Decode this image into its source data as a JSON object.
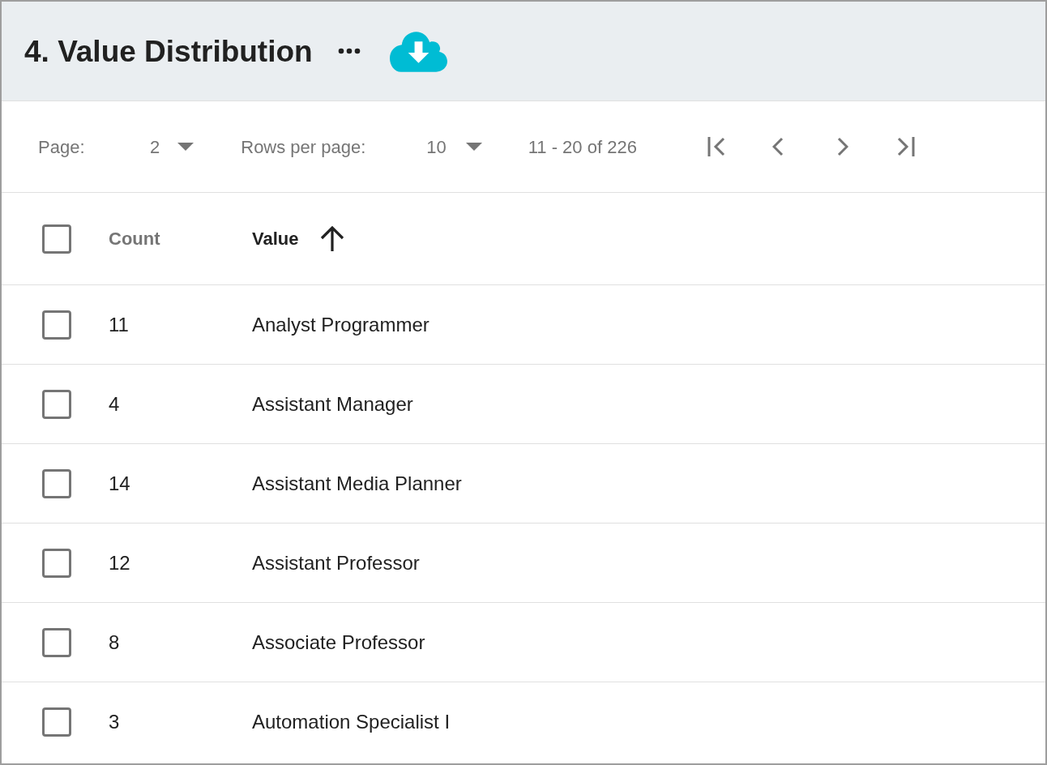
{
  "header": {
    "title": "4. Value Distribution"
  },
  "pagination": {
    "page_label": "Page:",
    "page": "2",
    "rows_per_page_label": "Rows per page:",
    "rows_per_page": "10",
    "range": "11 - 20 of 226"
  },
  "table": {
    "select_all": {
      "checked": false
    },
    "columns": [
      {
        "label": "Count",
        "sorted": false
      },
      {
        "label": "Value",
        "sorted": true
      }
    ],
    "rows": [
      {
        "checked": false,
        "count": "11",
        "value": "Analyst Programmer"
      },
      {
        "checked": false,
        "count": "4",
        "value": "Assistant Manager"
      },
      {
        "checked": false,
        "count": "14",
        "value": "Assistant Media Planner"
      },
      {
        "checked": false,
        "count": "12",
        "value": "Assistant Professor"
      },
      {
        "checked": false,
        "count": "8",
        "value": "Associate Professor"
      },
      {
        "checked": false,
        "count": "3",
        "value": "Automation Specialist I"
      }
    ]
  }
}
